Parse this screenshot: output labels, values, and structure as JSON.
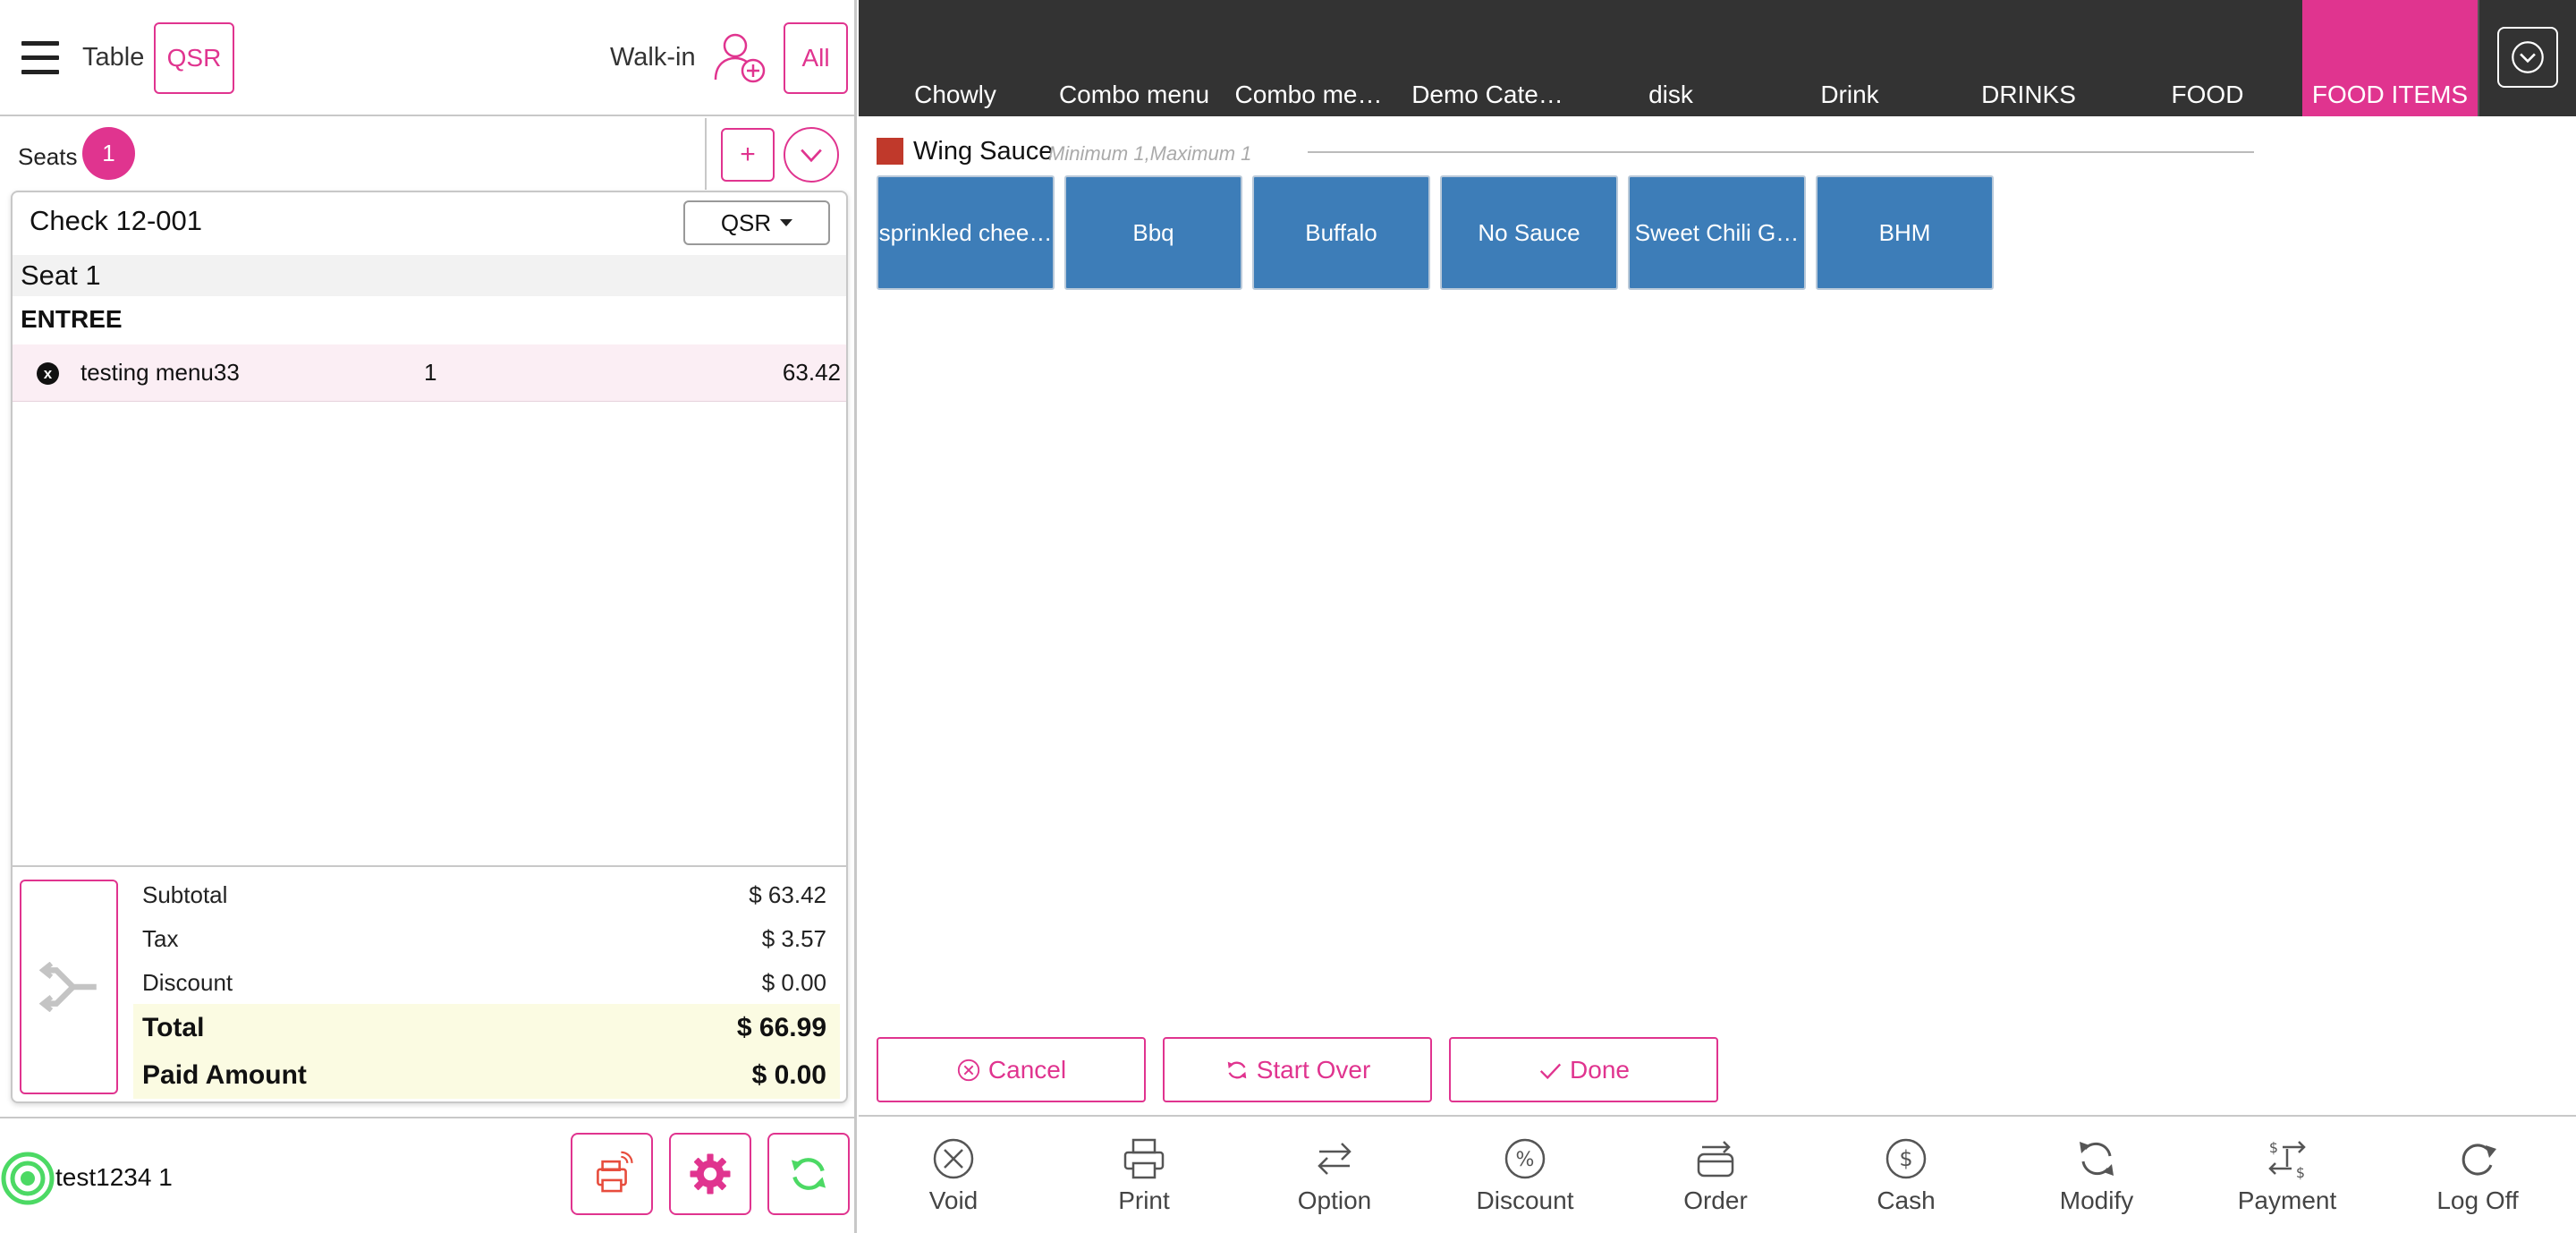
{
  "left_header": {
    "table_label": "Table",
    "qsr_label": "QSR",
    "walkin_label": "Walk-in",
    "all_label": "All"
  },
  "seats": {
    "label": "Seats",
    "count": "1",
    "add_symbol": "+"
  },
  "check": {
    "title": "Check 12-001",
    "order_type": "QSR",
    "seat_label": "Seat 1",
    "course_label": "ENTREE",
    "items": [
      {
        "name": "testing menu33",
        "qty": "1",
        "price": "63.42"
      }
    ],
    "remove_symbol": "x"
  },
  "totals": {
    "subtotal_label": "Subtotal",
    "subtotal_value": "$ 63.42",
    "tax_label": "Tax",
    "tax_value": "$ 3.57",
    "discount_label": "Discount",
    "discount_value": "$ 0.00",
    "total_label": "Total",
    "total_value": "$ 66.99",
    "paid_label": "Paid Amount",
    "paid_value": "$ 0.00"
  },
  "status": {
    "user": "test1234 1"
  },
  "categories": [
    {
      "label": "Chowly",
      "active": false
    },
    {
      "label": "Combo menu",
      "active": false
    },
    {
      "label": "Combo me…",
      "active": false
    },
    {
      "label": "Demo Cate…",
      "active": false
    },
    {
      "label": "disk",
      "active": false
    },
    {
      "label": "Drink",
      "active": false
    },
    {
      "label": "DRINKS",
      "active": false
    },
    {
      "label": "FOOD",
      "active": false
    },
    {
      "label": "FOOD ITEMS",
      "active": true
    }
  ],
  "modifier_group": {
    "name": "Wing Sauce",
    "rule": "Minimum 1,Maximum 1",
    "color": "#c0392b",
    "options": [
      "sprinkled chee…",
      "Bbq",
      "Buffalo",
      "No Sauce",
      "Sweet Chili G…",
      "BHM"
    ]
  },
  "actions": {
    "cancel": "Cancel",
    "start_over": "Start Over",
    "done": "Done"
  },
  "toolbar": {
    "void": "Void",
    "print": "Print",
    "option": "Option",
    "discount": "Discount",
    "order": "Order",
    "cash": "Cash",
    "modify": "Modify",
    "payment": "Payment",
    "logoff": "Log Off"
  },
  "colors": {
    "accent": "#e0348f",
    "category_bar": "#333333",
    "modifier_button": "#3d7db8",
    "total_highlight": "#fbfbe2"
  }
}
